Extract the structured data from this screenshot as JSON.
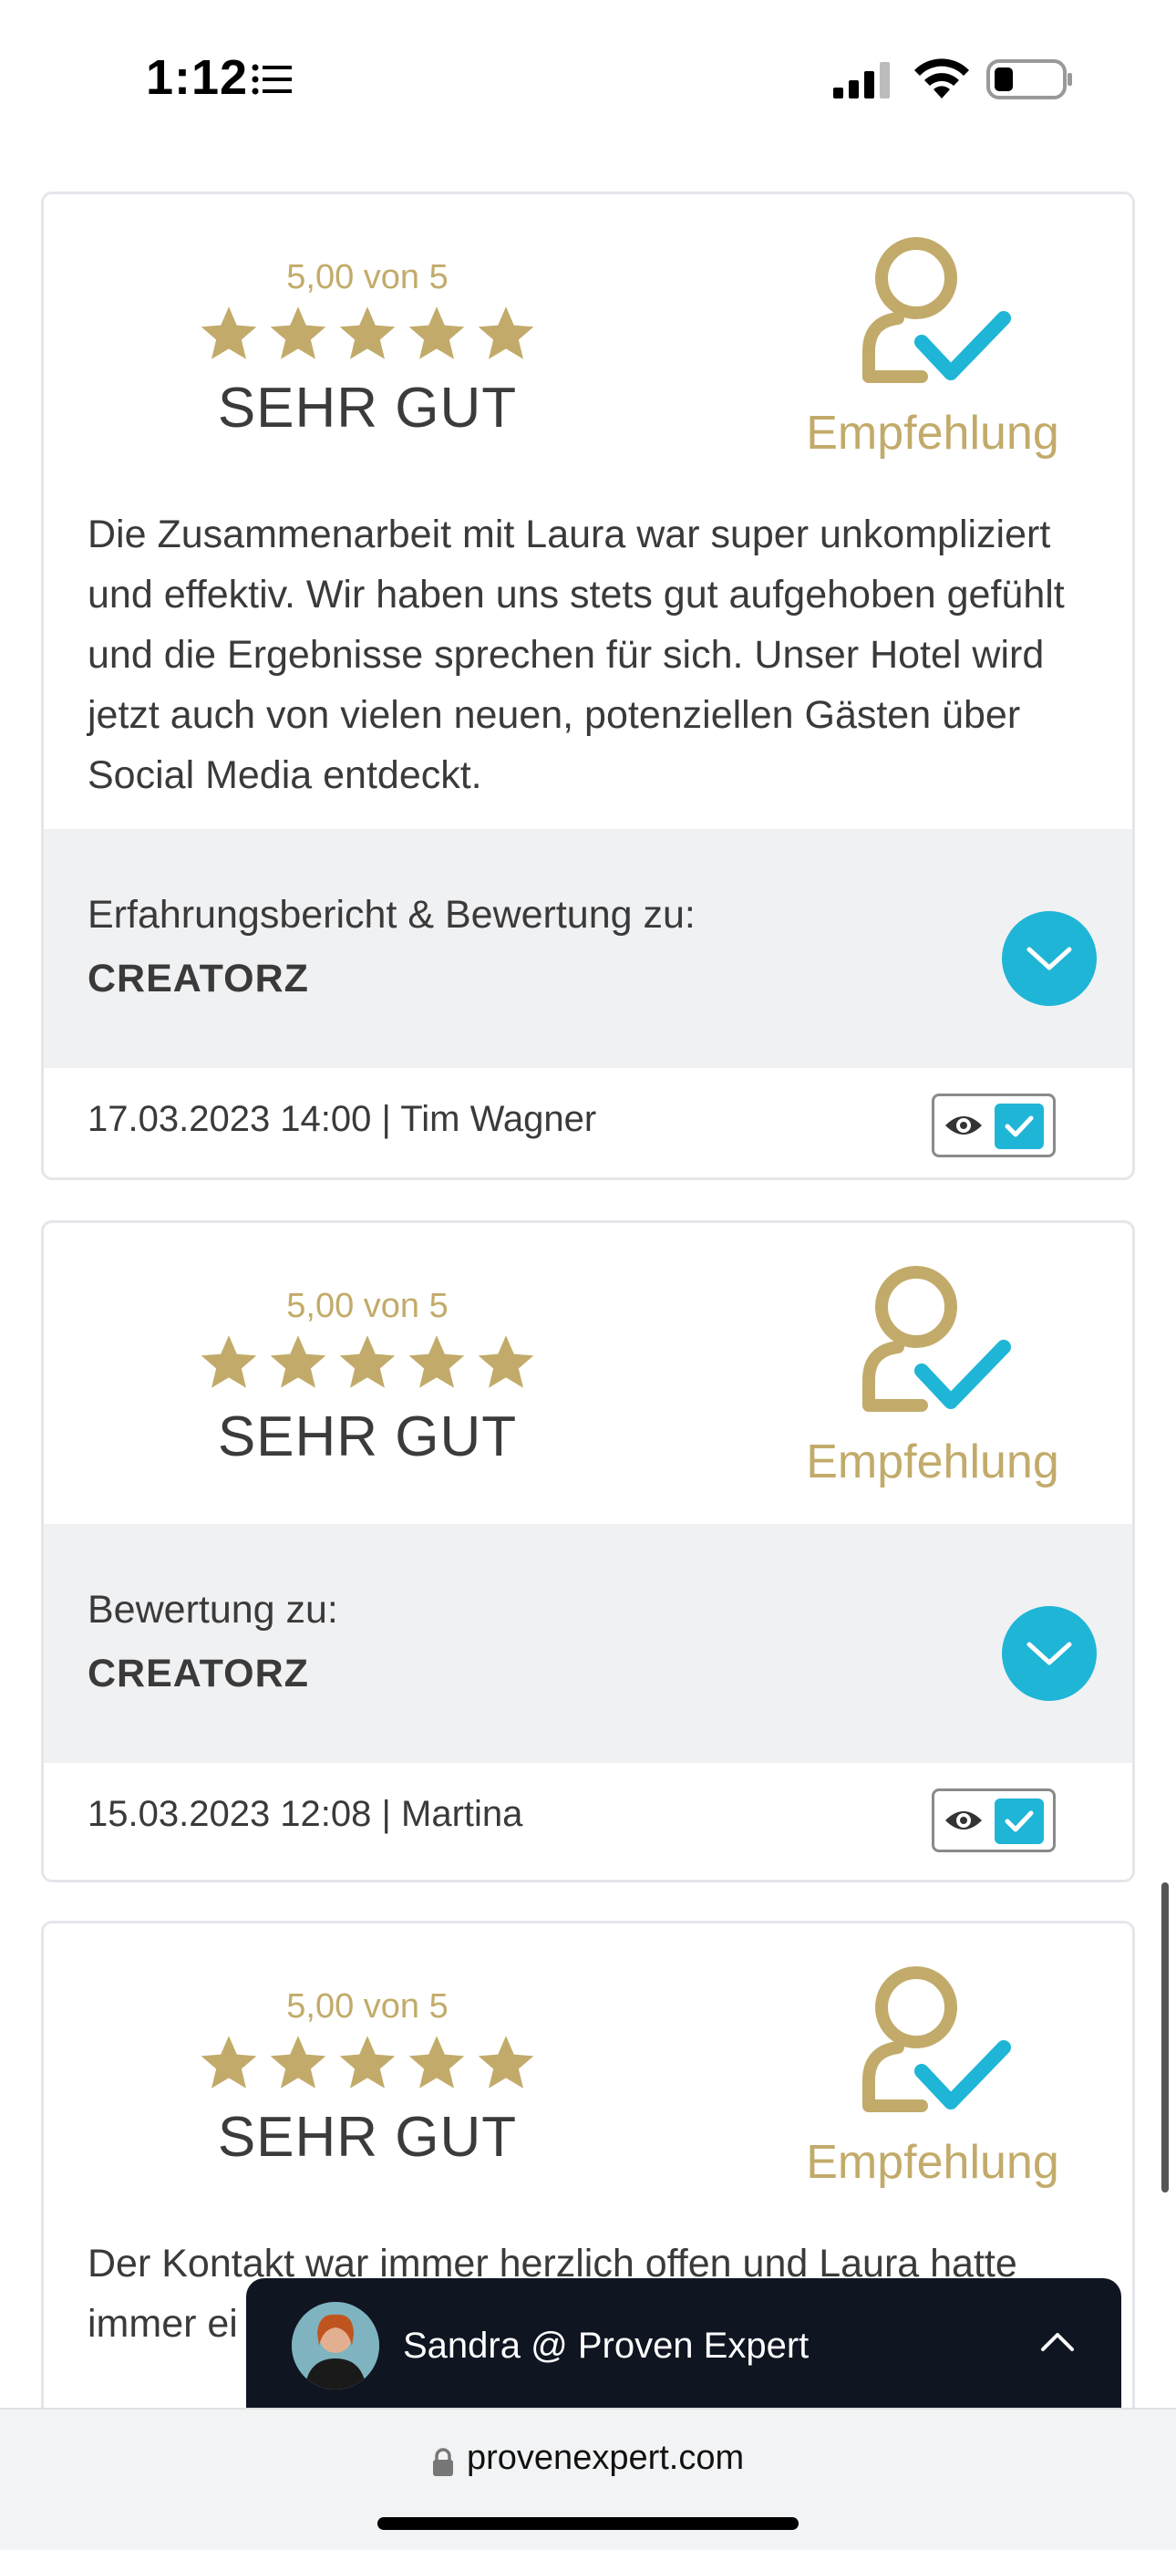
{
  "status_bar": {
    "time": "1:12"
  },
  "reviews": [
    {
      "score": "5,00 von 5",
      "verdict": "SEHR GUT",
      "recommendation": "Empfehlung",
      "text": "Die Zusammenarbeit mit Laura war super unkompliziert und effektiv. Wir haben uns stets gut aufgehoben gefühlt und die Ergebnisse sprechen für sich. Unser Hotel wird jetzt auch von vielen neuen, potenziellen Gästen über Social Media entdeckt.",
      "company_label": "Erfahrungsbericht & Bewertung zu:",
      "company_name": "CREATORZ",
      "meta": "17.03.2023 14:00 | Tim Wagner",
      "rating_stars": 5
    },
    {
      "score": "5,00 von 5",
      "verdict": "SEHR GUT",
      "recommendation": "Empfehlung",
      "company_label": "Bewertung zu:",
      "company_name": "CREATORZ",
      "meta": "15.03.2023 12:08 | Martina",
      "rating_stars": 5
    },
    {
      "score": "5,00 von 5",
      "verdict": "SEHR GUT",
      "recommendation": "Empfehlung",
      "text": "Der Kontakt war immer herzlich offen und Laura hatte immer ei",
      "rating_stars": 5
    }
  ],
  "chat": {
    "label": "Sandra @ Proven Expert"
  },
  "browser": {
    "url": "provenexpert.com"
  },
  "colors": {
    "gold": "#c2ab6a",
    "accent": "#1fb5d6",
    "chat_bg": "#101522"
  }
}
